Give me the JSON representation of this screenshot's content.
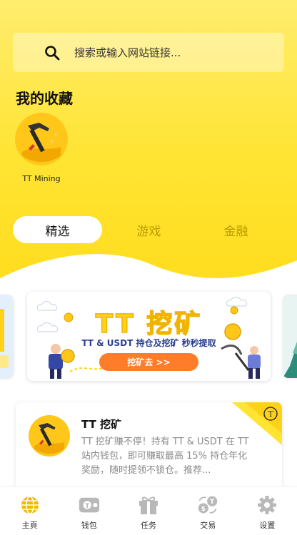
{
  "search": {
    "placeholder": "搜索或输入网站链接..."
  },
  "favorites": {
    "title": "我的收藏",
    "items": [
      {
        "label": "TT Mining",
        "icon": "pickaxe-icon"
      }
    ]
  },
  "tabs": [
    {
      "label": "精选",
      "active": true
    },
    {
      "label": "游戏",
      "active": false
    },
    {
      "label": "金融",
      "active": false
    }
  ],
  "banner": {
    "title": "TT 挖矿",
    "subtitle": "TT & USDT 持仓及挖矿 秒秒提取",
    "button_label": "挖矿去 >>"
  },
  "card": {
    "title": "TT 挖矿",
    "description": "TT 挖矿赚不停！持有 TT & USDT 在 TT 站内钱包，即可赚取最高 15% 持仓年化奖励，随时提领不锁仓。推荐..."
  },
  "bottom_nav": [
    {
      "label": "主頁",
      "icon": "globe-icon",
      "active": true
    },
    {
      "label": "钱包",
      "icon": "wallet-icon",
      "active": false
    },
    {
      "label": "任务",
      "icon": "gift-icon",
      "active": false
    },
    {
      "label": "交易",
      "icon": "exchange-icon",
      "active": false
    },
    {
      "label": "设置",
      "icon": "gear-icon",
      "active": false
    }
  ],
  "colors": {
    "brand_yellow": "#ffe433",
    "active_nav": "#f5b800",
    "inactive_nav": "#b8b8b8"
  }
}
